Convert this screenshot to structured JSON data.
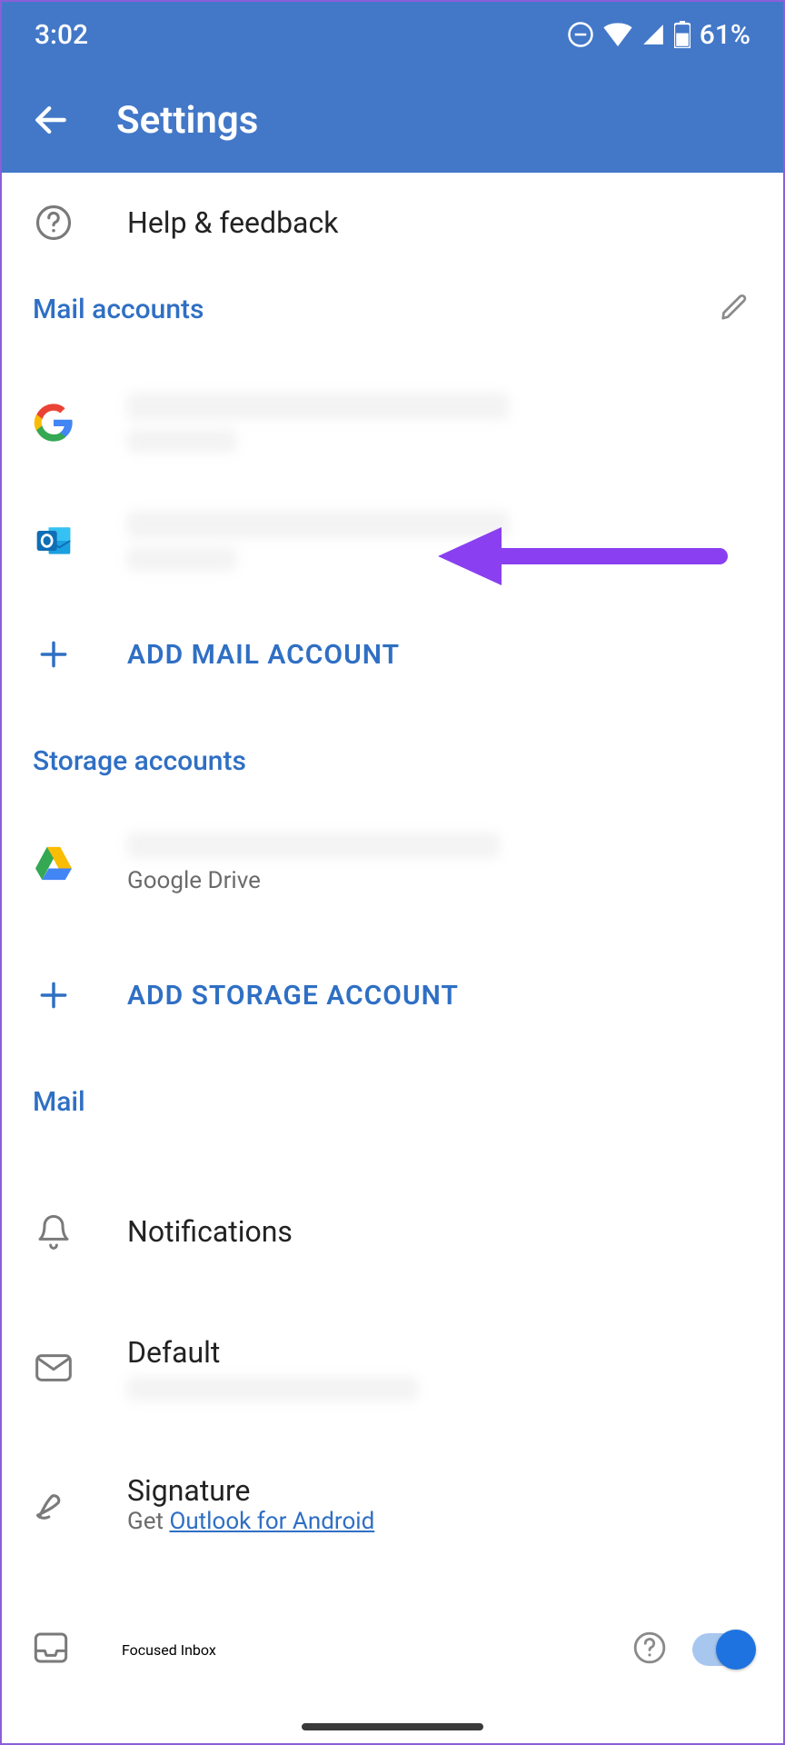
{
  "status": {
    "time": "3:02",
    "battery": "61%"
  },
  "header": {
    "title": "Settings"
  },
  "help": {
    "label": "Help & feedback"
  },
  "sections": {
    "mail_accounts": "Mail accounts",
    "storage_accounts": "Storage accounts",
    "mail": "Mail"
  },
  "add": {
    "mail": "ADD MAIL ACCOUNT",
    "storage": "ADD STORAGE ACCOUNT"
  },
  "storage": {
    "gdrive_label": "Google Drive"
  },
  "mail_settings": {
    "notifications": "Notifications",
    "default": "Default",
    "signature": "Signature",
    "signature_prefix": "Get ",
    "signature_link": "Outlook for Android",
    "focused_inbox": "Focused Inbox"
  }
}
